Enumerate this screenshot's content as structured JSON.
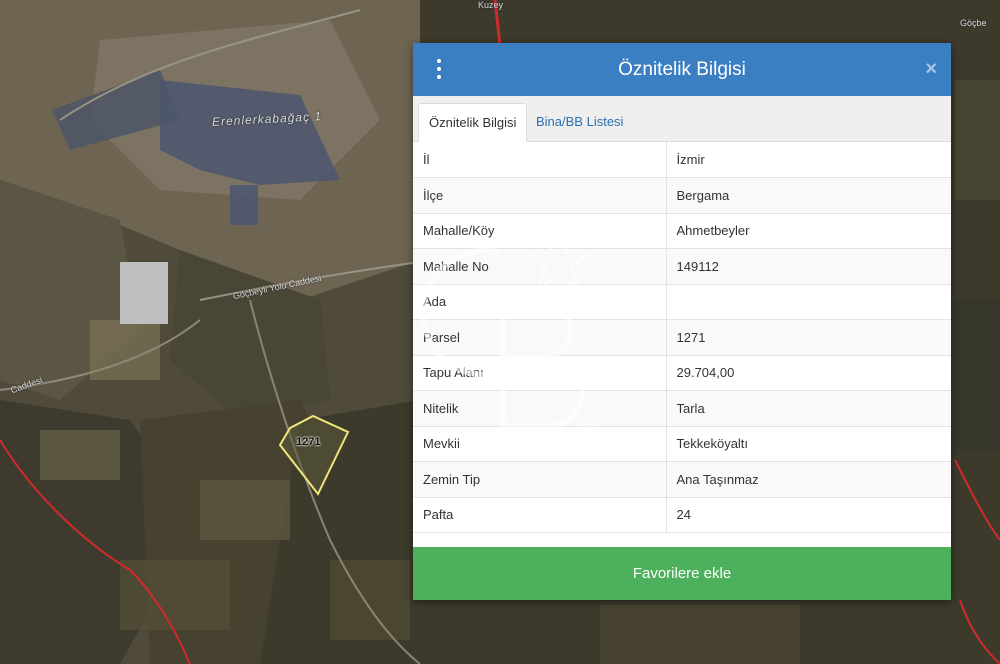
{
  "map": {
    "place_label": "Erenlerkabağaç 1",
    "road_label": "Göçbeyli Yolu Caddesi",
    "road_label_left": "Caddesi",
    "road_label_top_right": "Göçbe",
    "road_label_top": "Kuzey",
    "parcel_label": "1271",
    "colors": {
      "boundary": "#d12a2a",
      "parcel_outline": "#f1e67a"
    }
  },
  "panel": {
    "title": "Öznitelik Bilgisi",
    "menu_icon": "vertical-dots-icon",
    "close_icon": "×",
    "header_color": "#3a7fc1",
    "tabs": [
      {
        "label": "Öznitelik Bilgisi",
        "active": true
      },
      {
        "label": "Bina/BB Listesi",
        "active": false
      }
    ],
    "rows": [
      {
        "key": "İl",
        "value": "İzmir"
      },
      {
        "key": "İlçe",
        "value": "Bergama"
      },
      {
        "key": "Mahalle/Köy",
        "value": "Ahmetbeyler"
      },
      {
        "key": "Mahalle No",
        "value": "149112"
      },
      {
        "key": "Ada",
        "value": ""
      },
      {
        "key": "Parsel",
        "value": "1271"
      },
      {
        "key": "Tapu Alanı",
        "value": "29.704,00"
      },
      {
        "key": "Nitelik",
        "value": "Tarla"
      },
      {
        "key": "Mevkii",
        "value": "Tekkeköyaltı"
      },
      {
        "key": "Zemin Tip",
        "value": "Ana Taşınmaz"
      },
      {
        "key": "Pafta",
        "value": "24"
      }
    ],
    "favorite_button": "Favorilere ekle",
    "favorite_color": "#4cb05d"
  },
  "watermark": {
    "text": "SM"
  }
}
